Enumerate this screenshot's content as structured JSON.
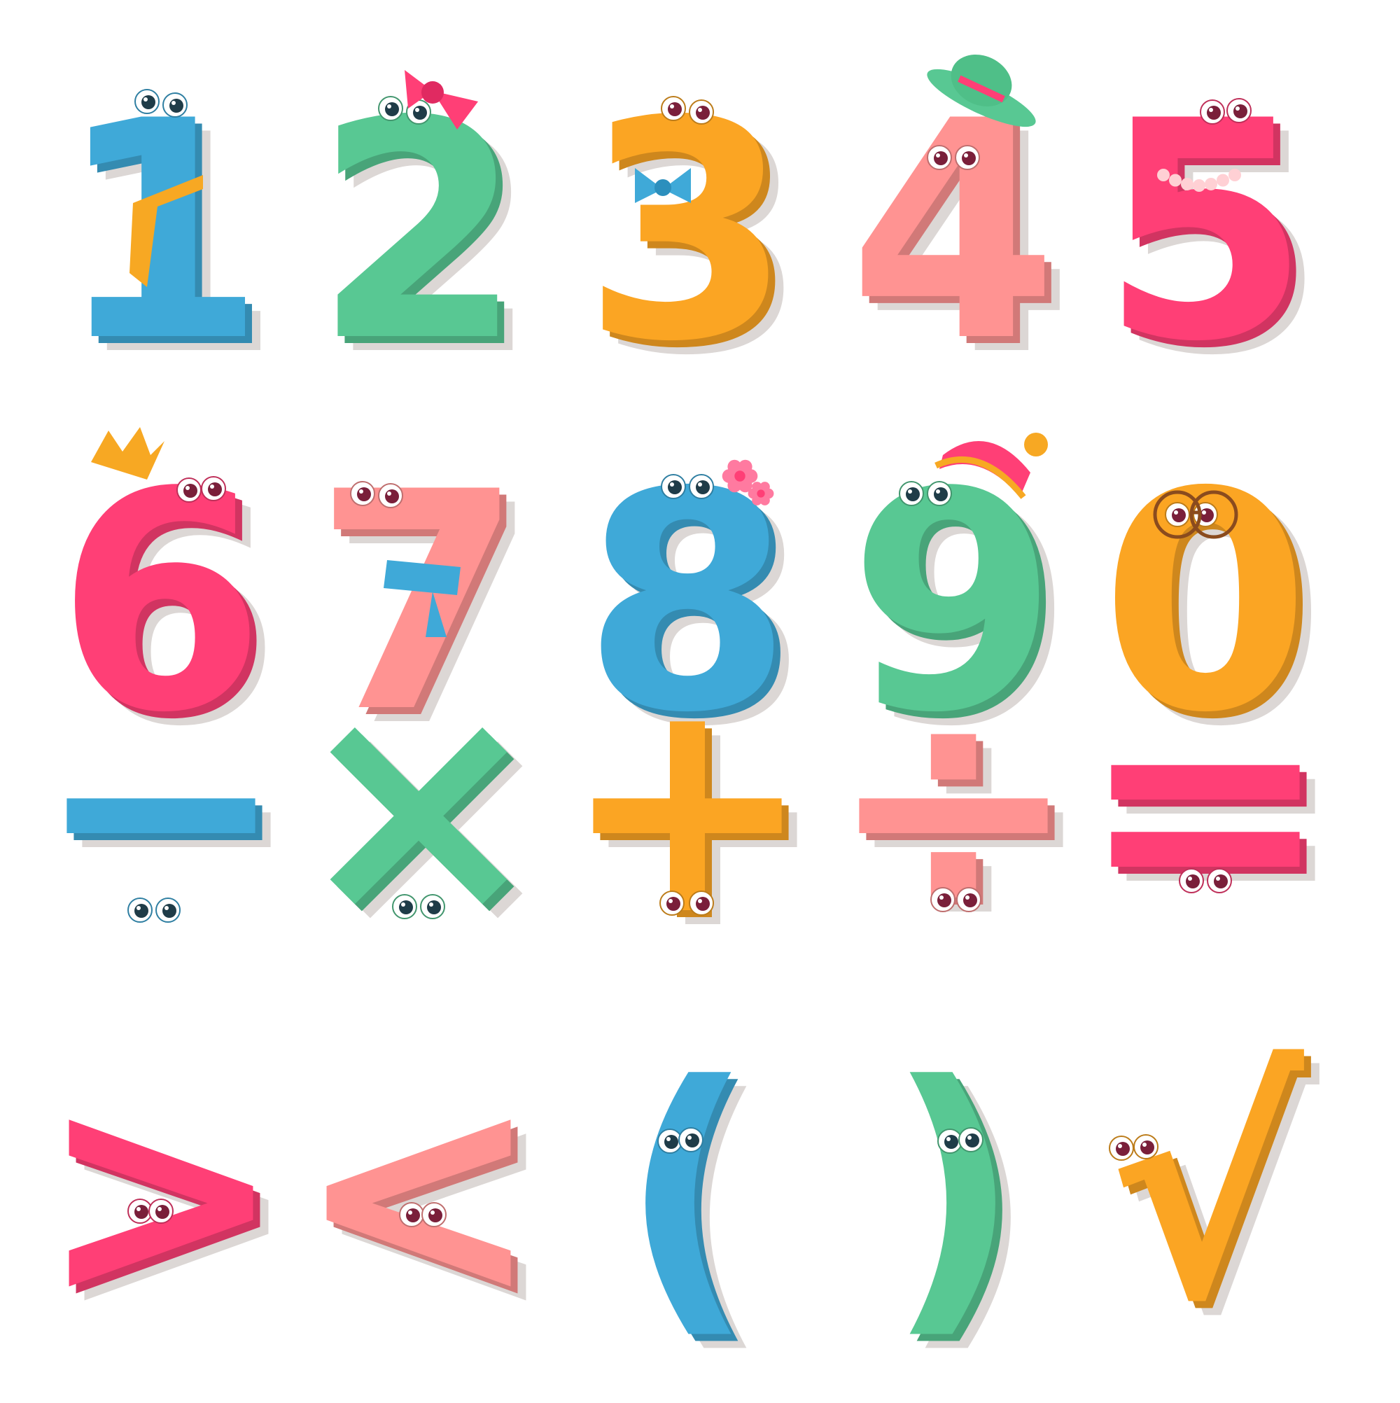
{
  "background": "#ffffff",
  "shadow_color": "#dcd7d5",
  "palette": {
    "blue": "#3fa9d8",
    "green": "#58c893",
    "orange": "#fba523",
    "pink": "#ff9392",
    "magenta": "#ff3f76"
  },
  "rows": [
    [
      {
        "text": "1",
        "kind": "digit",
        "color": "blue",
        "accessory": "orange tie"
      },
      {
        "text": "2",
        "kind": "digit",
        "color": "green",
        "accessory": "pink bow"
      },
      {
        "text": "3",
        "kind": "digit",
        "color": "orange",
        "accessory": "blue bow tie"
      },
      {
        "text": "4",
        "kind": "digit",
        "color": "pink",
        "accessory": "green hat"
      },
      {
        "text": "5",
        "kind": "digit",
        "color": "magenta",
        "accessory": "pearl necklace"
      }
    ],
    [
      {
        "text": "6",
        "kind": "digit",
        "color": "magenta",
        "accessory": "crown"
      },
      {
        "text": "7",
        "kind": "digit",
        "color": "pink",
        "accessory": "blue scarf"
      },
      {
        "text": "8",
        "kind": "digit",
        "color": "blue",
        "accessory": "flowers"
      },
      {
        "text": "9",
        "kind": "digit",
        "color": "green",
        "accessory": "knit hat"
      },
      {
        "text": "0",
        "kind": "digit",
        "color": "orange",
        "accessory": "glasses"
      }
    ],
    [
      {
        "text": "−",
        "kind": "operator",
        "color": "blue",
        "accessory": ""
      },
      {
        "text": "×",
        "kind": "operator",
        "color": "green",
        "accessory": ""
      },
      {
        "text": "+",
        "kind": "operator",
        "color": "orange",
        "accessory": ""
      },
      {
        "text": "÷",
        "kind": "operator",
        "color": "pink",
        "accessory": ""
      },
      {
        "text": "=",
        "kind": "operator",
        "color": "magenta",
        "accessory": ""
      }
    ],
    [
      {
        "text": ">",
        "kind": "operator",
        "color": "magenta",
        "accessory": ""
      },
      {
        "text": "<",
        "kind": "operator",
        "color": "pink",
        "accessory": ""
      },
      {
        "text": "(",
        "kind": "bracket",
        "color": "blue",
        "accessory": ""
      },
      {
        "text": ")",
        "kind": "bracket",
        "color": "green",
        "accessory": ""
      },
      {
        "text": "√",
        "kind": "operator",
        "color": "orange",
        "accessory": ""
      }
    ]
  ]
}
